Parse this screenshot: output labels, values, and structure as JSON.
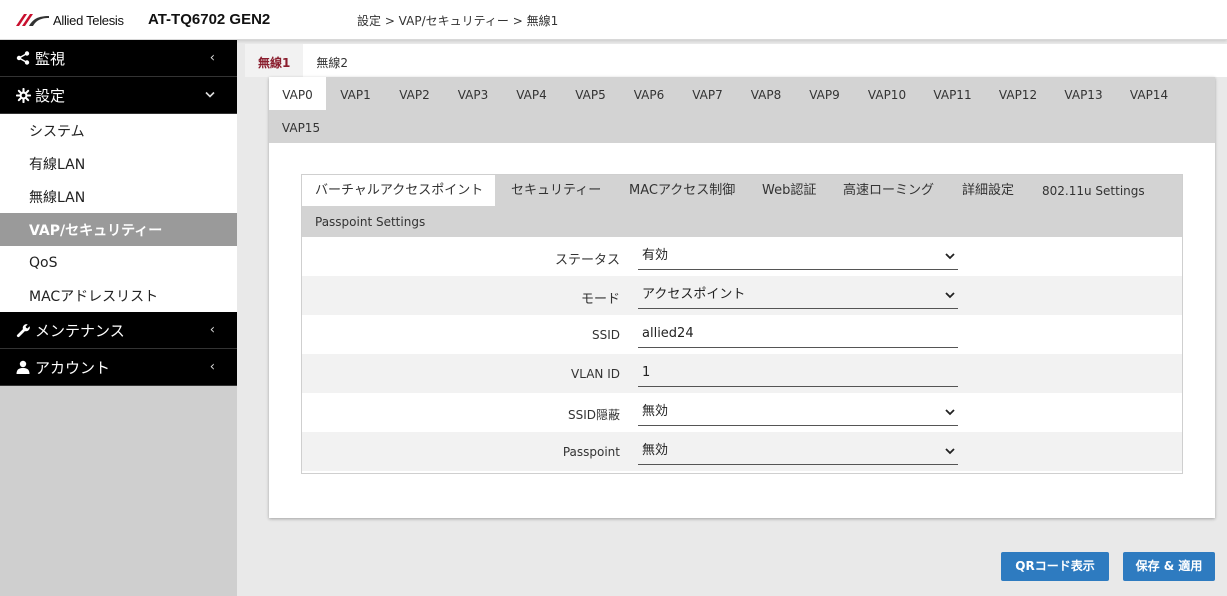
{
  "header": {
    "logo_text": "Allied Telesis",
    "model": "AT-TQ6702 GEN2",
    "breadcrumb": "設定 > VAP/セキュリティー > 無線1"
  },
  "sidebar": {
    "sections": [
      {
        "label": "監視",
        "icon": "share-icon",
        "chevron": "‹"
      },
      {
        "label": "設定",
        "icon": "gear-icon",
        "chevron": "⌄"
      }
    ],
    "sub_items": [
      {
        "label": "システム"
      },
      {
        "label": "有線LAN"
      },
      {
        "label": "無線LAN"
      },
      {
        "label": "VAP/セキュリティー"
      },
      {
        "label": "QoS"
      },
      {
        "label": "MACアドレスリスト"
      }
    ],
    "bottom_sections": [
      {
        "label": "メンテナンス",
        "icon": "wrench-icon",
        "chevron": "‹"
      },
      {
        "label": "アカウント",
        "icon": "user-icon",
        "chevron": "‹"
      }
    ]
  },
  "radio_tabs": [
    "無線1",
    "無線2"
  ],
  "vap_tabs": [
    "VAP0",
    "VAP1",
    "VAP2",
    "VAP3",
    "VAP4",
    "VAP5",
    "VAP6",
    "VAP7",
    "VAP8",
    "VAP9",
    "VAP10",
    "VAP11",
    "VAP12",
    "VAP13",
    "VAP14",
    "VAP15"
  ],
  "sub_tabs": [
    "バーチャルアクセスポイント",
    "セキュリティー",
    "MACアクセス制御",
    "Web認証",
    "高速ローミング",
    "詳細設定",
    "802.11u Settings",
    "Passpoint Settings"
  ],
  "form": [
    {
      "label": "ステータス",
      "value": "有効",
      "type": "select"
    },
    {
      "label": "モード",
      "value": "アクセスポイント",
      "type": "select"
    },
    {
      "label": "SSID",
      "value": "allied24",
      "type": "input"
    },
    {
      "label": "VLAN ID",
      "value": "1",
      "type": "input"
    },
    {
      "label": "SSID隠蔽",
      "value": "無効",
      "type": "select"
    },
    {
      "label": "Passpoint",
      "value": "無効",
      "type": "select"
    }
  ],
  "buttons": {
    "qr_label": "QRコード表示",
    "save_label": "保存 & 適用"
  },
  "colors": {
    "accent_red": "#8a1e2e",
    "button_blue": "#2e7bc0"
  }
}
